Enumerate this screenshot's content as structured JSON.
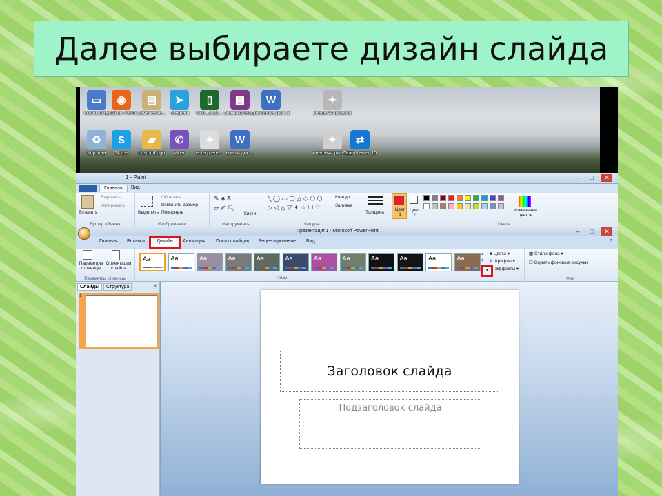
{
  "title": "Далее выбираете дизайн слайда",
  "desktop": {
    "icons": [
      {
        "label": "Компьютер",
        "icon": "computer-icon",
        "color": "#4a7ac8"
      },
      {
        "label": "Mozilla Firefox",
        "icon": "firefox-icon",
        "color": "#e8661c"
      },
      {
        "label": "Заявление...",
        "icon": "document-icon",
        "color": "#c9b27a"
      },
      {
        "label": "Telegram",
        "icon": "telegram-icon",
        "color": "#2aa3dd"
      },
      {
        "label": "icon_3025...",
        "icon": "phone-icon",
        "color": "#1d6b2b"
      },
      {
        "label": "Знакомьтесь...",
        "icon": "winrar-icon",
        "color": "#7b3b86"
      },
      {
        "label": "Описание урок обра...",
        "icon": "word-doc-icon",
        "color": "#3d6fc3"
      },
      {
        "label": "внешняя рисунок...",
        "icon": "image-icon",
        "color": "#b7b7b7"
      },
      {
        "label": "Корзина",
        "icon": "recycle-bin-icon",
        "color": "#8fb2d8"
      },
      {
        "label": "Skype",
        "icon": "skype-icon",
        "color": "#1ea0e6"
      },
      {
        "label": "customLogo",
        "icon": "folder-icon",
        "color": "#e7b94a"
      },
      {
        "label": "Viber",
        "icon": "viber-icon",
        "color": "#7a4fbf"
      },
      {
        "label": "enterprene...",
        "icon": "image-icon",
        "color": "#dcdcdc"
      },
      {
        "label": "новый док ...",
        "icon": "word-doc-icon",
        "color": "#3d6fc3"
      },
      {
        "label": "внешняя рисунок...",
        "icon": "image-icon",
        "color": "#cfcfcf"
      },
      {
        "label": "TeamViewer 10",
        "icon": "teamviewer-icon",
        "color": "#1577d1"
      }
    ]
  },
  "paint": {
    "title": "1 - Paint",
    "tabs": [
      "Главная",
      "Вид"
    ],
    "clipboard": {
      "paste": "Вставить",
      "cut": "Вырезать",
      "copy": "Копировать",
      "group": "Буфер обмена"
    },
    "image": {
      "select": "Выделить",
      "crop": "Обрезать",
      "resize": "Изменить размер",
      "rotate": "Повернуть",
      "group": "Изображение"
    },
    "tools": {
      "group": "Инструменты",
      "brushes": "Кисти"
    },
    "shapes": {
      "outline": "Контур",
      "fill": "Заливка",
      "group": "Фигуры"
    },
    "size": {
      "label": "Толщина"
    },
    "colors": {
      "color1": "Цвет 1",
      "color2": "Цвет 2",
      "edit": "Изменение цветов",
      "group": "Цвета",
      "palette": [
        "#000000",
        "#7f7f7f",
        "#880015",
        "#ed1c24",
        "#ff7f27",
        "#fff200",
        "#22b14c",
        "#00a2e8",
        "#3f48cc",
        "#a349a4",
        "#ffffff",
        "#c3c3c3",
        "#b97a57",
        "#ffaec9",
        "#ffc90e",
        "#efe4b0",
        "#b5e61d",
        "#99d9ea",
        "#7092be",
        "#c8bfe7"
      ]
    }
  },
  "ppt": {
    "title": "Презентация1 - Microsoft PowerPoint",
    "tabs": [
      "Главная",
      "Вставка",
      "Дизайн",
      "Анимация",
      "Показ слайдов",
      "Рецензирование",
      "Вид"
    ],
    "page_setup": {
      "btn1": "Параметры страницы",
      "btn2": "Ориентация слайда",
      "group": "Параметры страницы"
    },
    "themes": {
      "group": "Темы",
      "sample": "Aa",
      "items": [
        "#ffffff",
        "#ffffff",
        "#9a8ea0",
        "#7a7a7a",
        "#5e6a5e",
        "#3b4a6b",
        "#b04fa0",
        "#6f7f6a",
        "#111111",
        "#141414",
        "#ffffff",
        "#8a6b52"
      ],
      "text_colors": [
        "#000",
        "#000",
        "#fff",
        "#fff",
        "#fff",
        "#fff",
        "#fff",
        "#fff",
        "#fff",
        "#fff",
        "#000",
        "#fff"
      ]
    },
    "theme_opts": {
      "colors": "Цвета",
      "fonts": "Шрифты",
      "effects": "Эффекты"
    },
    "background": {
      "styles": "Стили фона",
      "hide": "Скрыть фоновые рисунки",
      "group": "Фон"
    },
    "pane_tabs": [
      "Слайды",
      "Структура"
    ],
    "slide_number": "1",
    "slide": {
      "title": "Заголовок слайда",
      "subtitle": "Подзаголовок слайда"
    }
  }
}
